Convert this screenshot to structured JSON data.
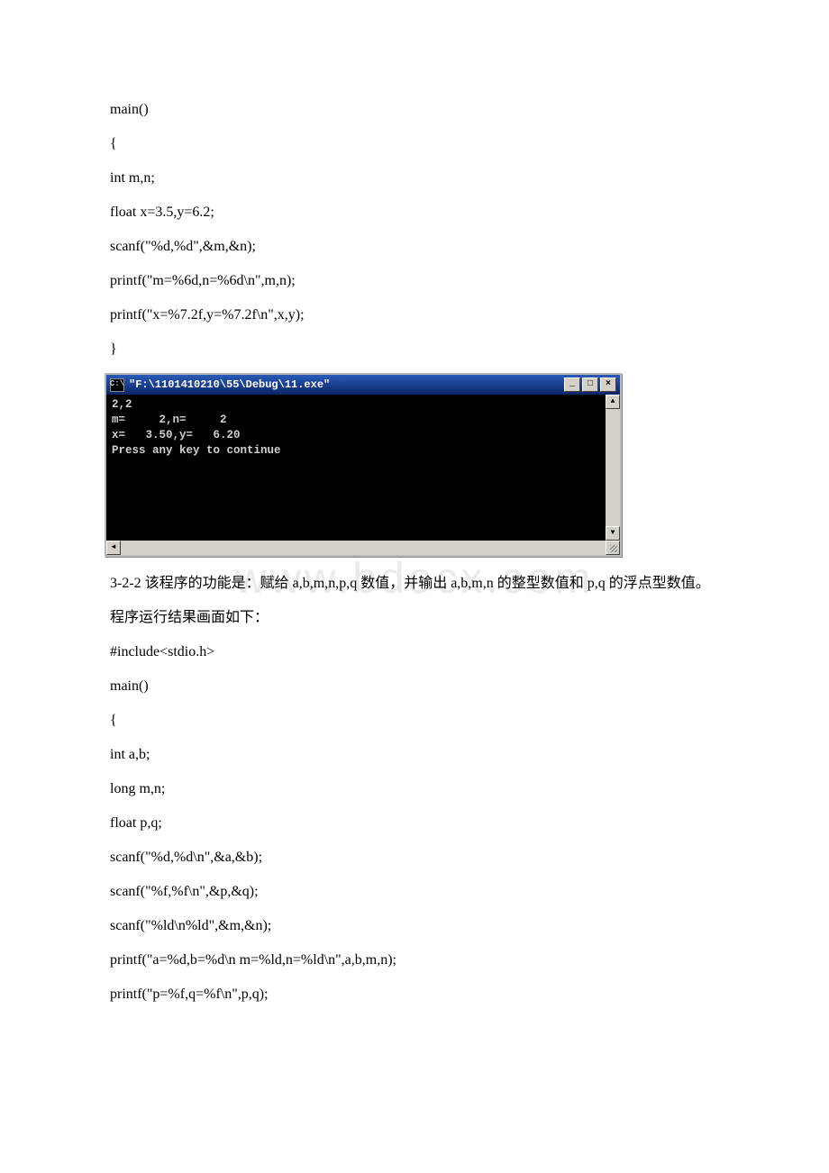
{
  "watermark": "www.bdocx.com",
  "code1": {
    "l1": "main()",
    "l2": "{",
    "l3": " int m,n;",
    "l4": " float x=3.5,y=6.2;",
    "l5": " scanf(\"%d,%d\",&m,&n);",
    "l6": " printf(\"m=%6d,n=%6d\\n\",m,n);",
    "l7": " printf(\"x=%7.2f,y=%7.2f\\n\",x,y);",
    "l8": "}"
  },
  "console": {
    "icon": "C:\\",
    "title": "\"F:\\1101410210\\55\\Debug\\11.exe\"",
    "min": "_",
    "max": "□",
    "close": "×",
    "out": "2,2\nm=     2,n=     2\nx=   3.50,y=   6.20\nPress any key to continue",
    "up": "▲",
    "down": "▼",
    "left": "◄",
    "right": "►"
  },
  "para1": "3-2-2 该程序的功能是：赋给 a,b,m,n,p,q 数值，并输出 a,b,m,n 的整型数值和 p,q 的浮点型数值。",
  "para2": "程序运行结果画面如下：",
  "code2": {
    "l1": "#include<stdio.h>",
    "l2": "main()",
    "l3": "{",
    "l4": " int a,b;",
    "l5": " long m,n;",
    "l6": " float p,q;",
    "l7": " scanf(\"%d,%d\\n\",&a,&b);",
    "l8": " scanf(\"%f,%f\\n\",&p,&q);",
    "l9": " scanf(\"%ld\\n%ld\",&m,&n);",
    "l10": " printf(\"a=%d,b=%d\\n m=%ld,n=%ld\\n\",a,b,m,n);",
    "l11": " printf(\"p=%f,q=%f\\n\",p,q);"
  }
}
